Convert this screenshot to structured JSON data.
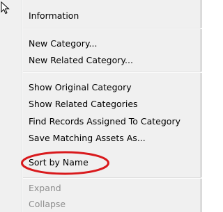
{
  "context_menu": {
    "items": [
      {
        "label": "Information",
        "enabled": true
      },
      {
        "label": "New Category...",
        "enabled": true
      },
      {
        "label": "New Related Category...",
        "enabled": true
      },
      {
        "label": "Show Original Category",
        "enabled": true
      },
      {
        "label": "Show Related Categories",
        "enabled": true
      },
      {
        "label": "Find Records Assigned To Category",
        "enabled": true
      },
      {
        "label": "Save Matching Assets As...",
        "enabled": true
      },
      {
        "label": "Sort by Name",
        "enabled": true
      },
      {
        "label": "Expand",
        "enabled": false
      },
      {
        "label": "Collapse",
        "enabled": false
      }
    ]
  },
  "annotation": {
    "highlight_color": "#d9191c",
    "highlighted_item": "Sort by Name"
  },
  "colors": {
    "menu_background": "#f0f0f0",
    "disabled_text": "#8d8d8d"
  }
}
